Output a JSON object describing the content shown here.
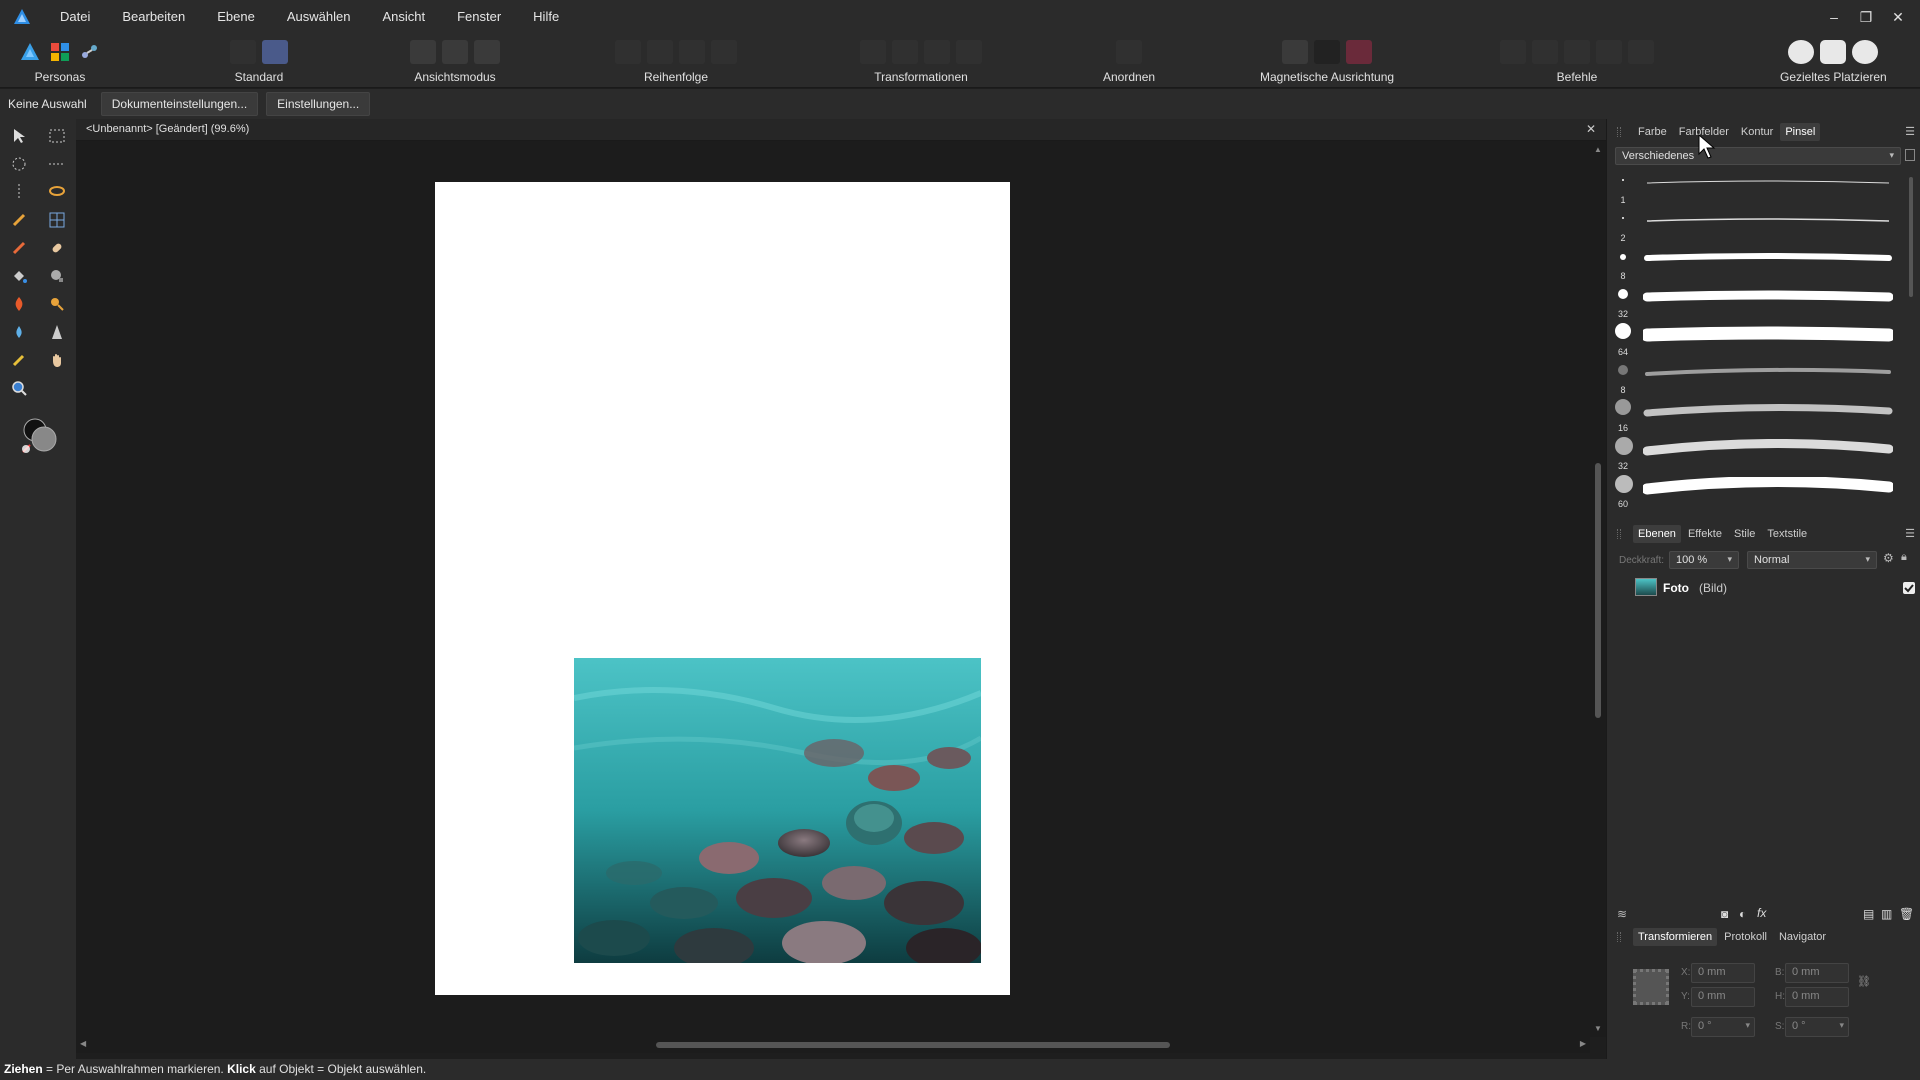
{
  "menu": {
    "items": [
      "Datei",
      "Bearbeiten",
      "Ebene",
      "Auswählen",
      "Ansicht",
      "Fenster",
      "Hilfe"
    ]
  },
  "window_controls": {
    "minimize": "–",
    "restore": "❐",
    "close": "✕"
  },
  "toolbar": {
    "personas": "Personas",
    "standard": "Standard",
    "ansichtsmodus": "Ansichtsmodus",
    "reihenfolge": "Reihenfolge",
    "transformationen": "Transformationen",
    "anordnen": "Anordnen",
    "magnetische": "Magnetische Ausrichtung",
    "befehle": "Befehle",
    "gezieltes": "Gezieltes Platzieren"
  },
  "context": {
    "selection": "Keine Auswahl",
    "doc_settings": "Dokumenteinstellungen...",
    "settings": "Einstellungen..."
  },
  "document": {
    "title": "<Unbenannt> [Geändert] (99.6%)",
    "close": "✕"
  },
  "panel_top": {
    "tabs": [
      "Farbe",
      "Farbfelder",
      "Kontur",
      "Pinsel"
    ],
    "active_tab": "Pinsel",
    "category": "Verschiedenes",
    "brushes": [
      {
        "size": "1"
      },
      {
        "size": "2"
      },
      {
        "size": "8"
      },
      {
        "size": "32"
      },
      {
        "size": "64"
      },
      {
        "size": "8"
      },
      {
        "size": "16"
      },
      {
        "size": "32"
      },
      {
        "size": "60"
      }
    ]
  },
  "panel_layers": {
    "tabs": [
      "Ebenen",
      "Effekte",
      "Stile",
      "Textstile"
    ],
    "active_tab": "Ebenen",
    "opacity_label": "Deckkraft:",
    "opacity": "100 %",
    "blend": "Normal",
    "layer_name": "Foto",
    "layer_type": "(Bild)"
  },
  "panel_transform": {
    "tabs": [
      "Transformieren",
      "Protokoll",
      "Navigator"
    ],
    "active_tab": "Transformieren",
    "x_label": "X:",
    "x": "0 mm",
    "y_label": "Y:",
    "y": "0 mm",
    "w_label": "B:",
    "w": "0 mm",
    "h_label": "H:",
    "h": "0 mm",
    "r_label": "R:",
    "r": "0 °",
    "s_label": "S:",
    "s": "0 °"
  },
  "status": {
    "drag_key": "Ziehen",
    "drag_text": " = Per Auswahlrahmen markieren. ",
    "click_key": "Klick",
    "click_text": " auf Objekt = Objekt auswählen."
  },
  "colors": {
    "accent_logo": "#2f8fe6",
    "background": "#1c1c1c",
    "panel": "#2b2b2b",
    "water": "#2aa9a8"
  }
}
